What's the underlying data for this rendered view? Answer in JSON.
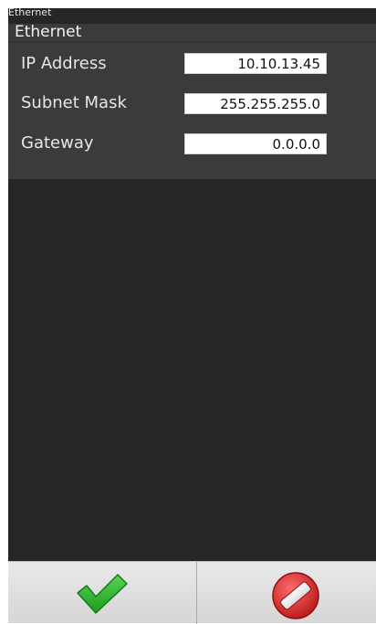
{
  "window": {
    "title": "Ethernet"
  },
  "panel": {
    "title": "Ethernet",
    "fields": [
      {
        "label": "IP Address",
        "value": "10.10.13.45"
      },
      {
        "label": "Subnet Mask",
        "value": "255.255.255.0"
      },
      {
        "label": "Gateway",
        "value": "0.0.0.0"
      }
    ]
  },
  "buttons": {
    "ok_icon": "checkmark-icon",
    "cancel_icon": "cancel-icon"
  },
  "colors": {
    "frame": "#262626",
    "panel": "#3b3b3b",
    "ok_green": "#2db82d",
    "cancel_red": "#d42a2a"
  }
}
